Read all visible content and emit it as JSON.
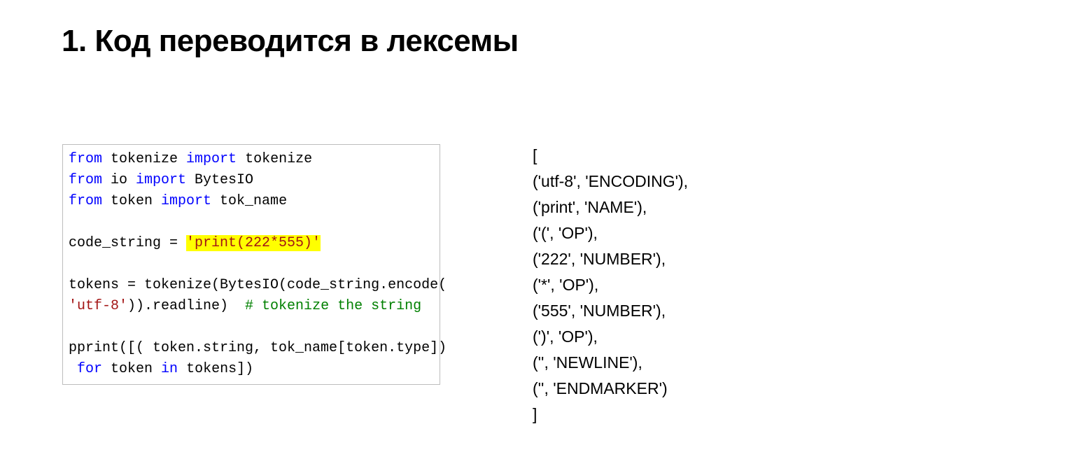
{
  "title": "1. Код переводится в лексемы",
  "code": {
    "l1_from": "from",
    "l1_mod": " tokenize ",
    "l1_import": "import",
    "l1_rest": " tokenize",
    "l2_from": "from",
    "l2_mod": " io ",
    "l2_import": "import",
    "l2_rest": " BytesIO",
    "l3_from": "from",
    "l3_mod": " token ",
    "l3_import": "import",
    "l3_rest": " tok_name",
    "l5_lhs": "code_string = ",
    "l5_str": "'print(222*555)'",
    "l7": "tokens = tokenize(BytesIO(code_string.encode(",
    "l8_str": "'utf-8'",
    "l8_mid": ")).readline)  ",
    "l8_cmt": "# tokenize the string",
    "l10": "pprint([( token.string, tok_name[token.type])",
    "l11_pre": " ",
    "l11_for": "for",
    "l11_mid": " token ",
    "l11_in": "in",
    "l11_rest": " tokens])"
  },
  "output": {
    "open": "[",
    "lines": [
      "('utf-8', 'ENCODING'),",
      "('print', 'NAME'),",
      "('(', 'OP'),",
      "('222', 'NUMBER'),",
      "('*', 'OP'),",
      "('555', 'NUMBER'),",
      "(')', 'OP'),",
      "('', 'NEWLINE'),",
      "('', 'ENDMARKER')"
    ],
    "close": "]"
  }
}
